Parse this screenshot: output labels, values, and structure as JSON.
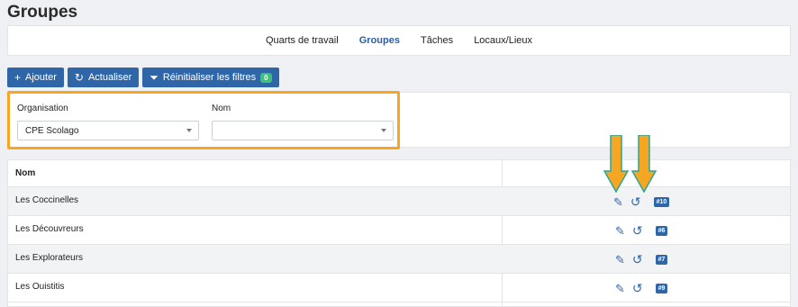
{
  "page": {
    "title": "Groupes"
  },
  "tabs": [
    {
      "label": "Quarts de travail",
      "active": false
    },
    {
      "label": "Groupes",
      "active": true
    },
    {
      "label": "Tâches",
      "active": false
    },
    {
      "label": "Locaux/Lieux",
      "active": false
    }
  ],
  "toolbar": {
    "add_label": "Ajouter",
    "refresh_label": "Actualiser",
    "reset_label": "Réinitialiser les filtres",
    "reset_count": "0"
  },
  "filters": {
    "organisation_label": "Organisation",
    "organisation_value": "CPE Scolago",
    "nom_label": "Nom",
    "nom_value": ""
  },
  "table": {
    "header_nom": "Nom",
    "rows": [
      {
        "name": "Les Coccinelles",
        "id": "#10"
      },
      {
        "name": "Les Découvreurs",
        "id": "#6"
      },
      {
        "name": "Les Explorateurs",
        "id": "#7"
      },
      {
        "name": "Les Ouistitis",
        "id": "#9"
      }
    ]
  },
  "annotation_color": "#f5a623",
  "accent_color": "#2f66a8"
}
